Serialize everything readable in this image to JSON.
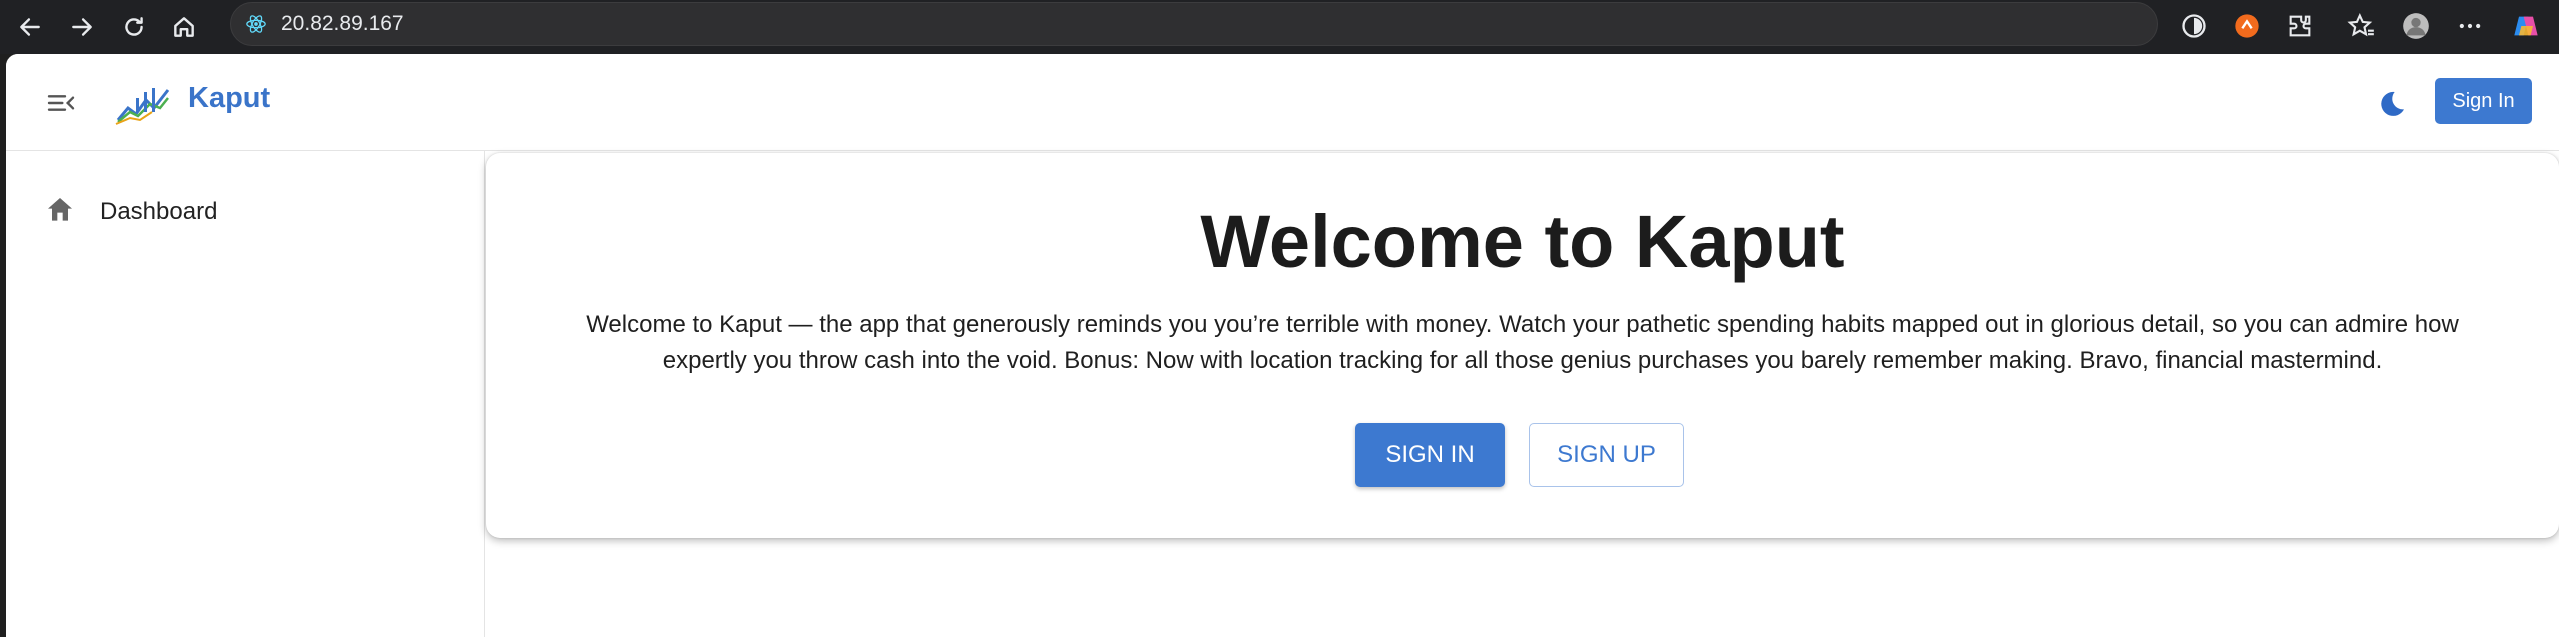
{
  "browser": {
    "url": "20.82.89.167",
    "icons": [
      "back-icon",
      "forward-icon",
      "reload-icon",
      "home-icon",
      "site-info-icon",
      "extension-icon",
      "extension-orange-icon",
      "puzzle-icon",
      "favorites-icon",
      "profile-icon",
      "more-icon",
      "copilot-icon"
    ]
  },
  "header": {
    "brand": "Kaput",
    "signin_label": "Sign In",
    "icons": [
      "menu-collapse-icon",
      "logo-icon",
      "dark-mode-icon"
    ]
  },
  "sidebar": {
    "items": [
      {
        "label": "Dashboard",
        "icon": "home-icon"
      }
    ]
  },
  "main": {
    "title": "Welcome to Kaput",
    "description": "Welcome to Kaput — the app that generously reminds you you’re terrible with money. Watch your pathetic spending habits mapped out in glorious detail, so you can admire how expertly you throw cash into the void. Bonus: Now with location tracking for all those genius purchases you barely remember making. Bravo, financial mastermind.",
    "signin_label": "SIGN IN",
    "signup_label": "SIGN UP"
  },
  "colors": {
    "accent": "#3d79d0",
    "brand": "#3a74c9",
    "chrome": "#202124"
  }
}
